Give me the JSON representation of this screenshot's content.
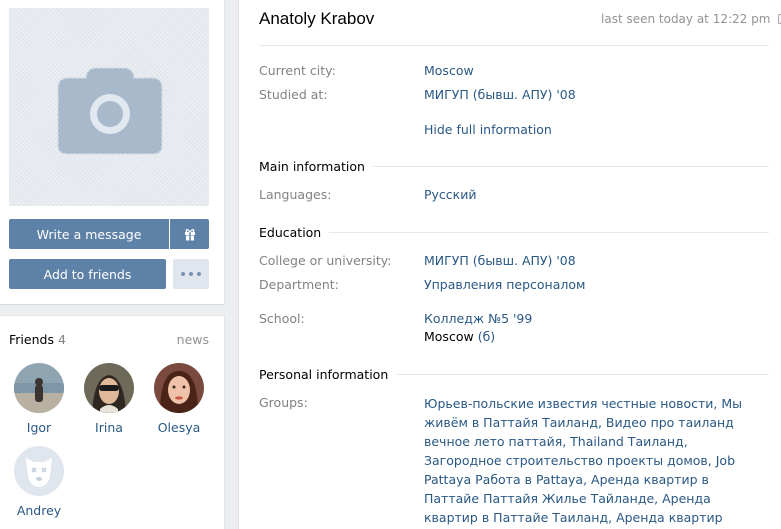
{
  "profile": {
    "name": "Anatoly Krabov",
    "last_seen": "last seen today at 12:22 pm"
  },
  "actions": {
    "write_message": "Write a message",
    "add_to_friends": "Add to friends"
  },
  "friends": {
    "title": "Friends",
    "count": "4",
    "news": "news",
    "items": [
      {
        "name": "Igor"
      },
      {
        "name": "Irina"
      },
      {
        "name": "Olesya"
      },
      {
        "name": "Andrey"
      }
    ]
  },
  "short_info": {
    "current_city_label": "Current city:",
    "current_city": "Moscow",
    "studied_label": "Studied at:",
    "studied": "МИГУП (бывш. АПУ) '08",
    "hide_full": "Hide full information"
  },
  "main_info": {
    "title": "Main information",
    "languages_label": "Languages:",
    "languages": "Русский"
  },
  "education": {
    "title": "Education",
    "college_label": "College or university:",
    "college": "МИГУП (бывш. АПУ) '08",
    "department_label": "Department:",
    "department": "Управления персоналом",
    "school_label": "School:",
    "school": "Колледж №5 '99",
    "school_city": "Moscow",
    "school_class": "(б)"
  },
  "personal": {
    "title": "Personal information",
    "groups_label": "Groups:",
    "groups": "Юрьев-польские известия честные новости, Мы живём в Паттайя Таиланд, Видео про таиланд вечное лето паттайя, Thailand Таиланд, Загородное строительство проекты домов, Job Pattaya Работа в Pattaya, Аренда квартир в Паттайе Паттайя Жилье Тайланде, Аренда квартир в Паттайе Таиланд, Аренда квартир мотобайков в Паттайе Тайланде, Недвижимость"
  },
  "colors": {
    "accent": "#5e81a8",
    "link": "#2a5885",
    "label": "#828282",
    "background": "#edeef0"
  },
  "icons": [
    "camera-icon",
    "gift-icon",
    "more-icon",
    "phone-icon",
    "dog-avatar-icon"
  ]
}
